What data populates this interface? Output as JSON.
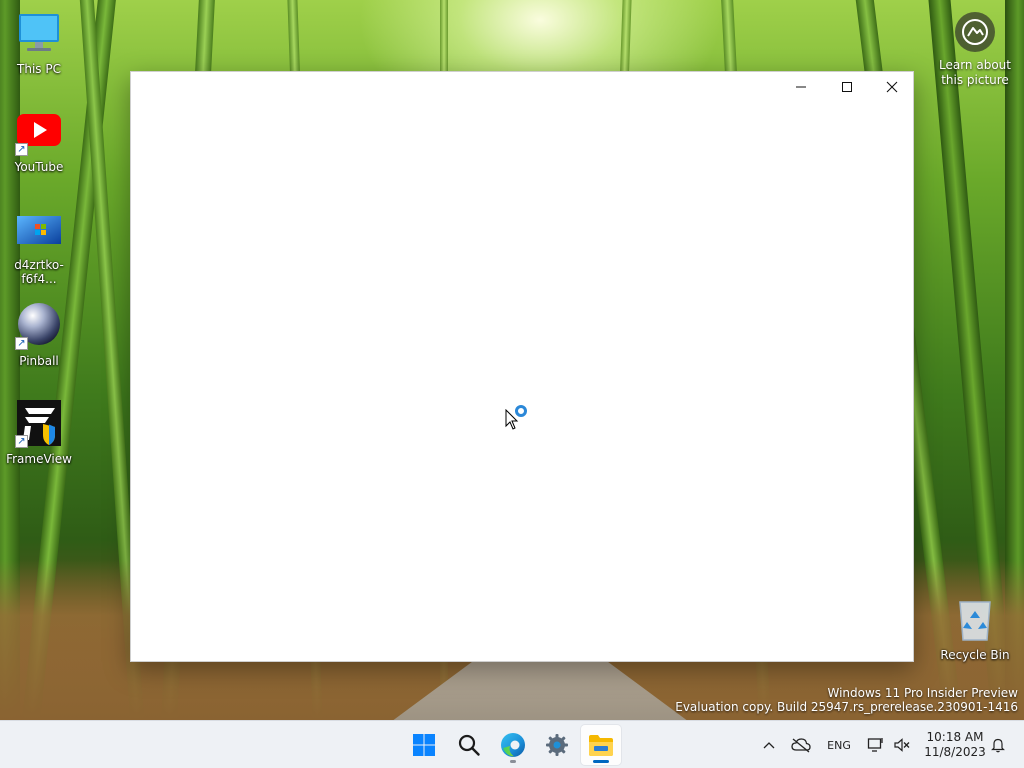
{
  "desktop": {
    "icons": [
      {
        "label": "This PC",
        "icon": "this-pc-icon"
      },
      {
        "label": "YouTube",
        "icon": "youtube-icon"
      },
      {
        "label": "d4zrtko-f6f4...",
        "icon": "image-file-icon"
      },
      {
        "label": "Pinball",
        "icon": "pinball-icon"
      },
      {
        "label": "FrameView",
        "icon": "frameview-icon"
      },
      {
        "label": "Recycle Bin",
        "icon": "recycle-bin-icon"
      }
    ],
    "learn_about_picture": "Learn about this picture"
  },
  "window": {
    "state": "loading",
    "controls": {
      "minimize": "minimize-icon",
      "maximize": "maximize-icon",
      "close": "close-icon"
    }
  },
  "watermark": {
    "line1": "Windows 11 Pro Insider Preview",
    "line2": "Evaluation copy. Build 25947.rs_prerelease.230901-1416"
  },
  "taskbar": {
    "pinned": [
      {
        "name": "Start",
        "icon": "windows-start-icon"
      },
      {
        "name": "Search",
        "icon": "search-icon"
      },
      {
        "name": "Microsoft Edge",
        "icon": "edge-icon"
      },
      {
        "name": "Settings",
        "icon": "settings-gear-icon"
      },
      {
        "name": "File Explorer",
        "icon": "file-explorer-icon",
        "active": true
      }
    ],
    "tray": {
      "language": "ENG",
      "time": "10:18 AM",
      "date": "11/8/2023"
    }
  },
  "colors": {
    "accent": "#0067c0",
    "youtube_red": "#ff0000",
    "taskbar_bg": "#eef1f5",
    "spinner": "#2b88d8"
  }
}
